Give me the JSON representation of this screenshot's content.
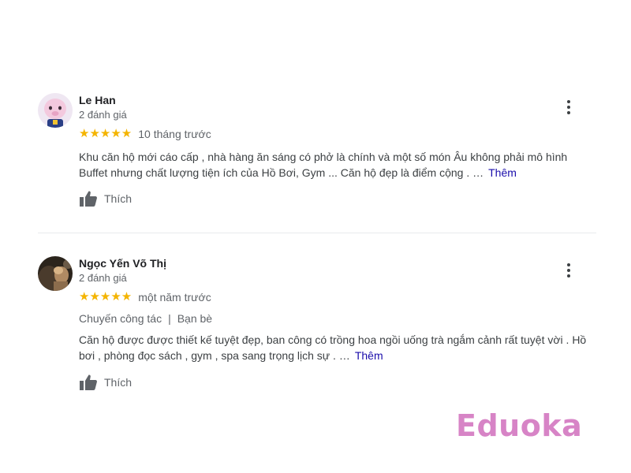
{
  "reviews": [
    {
      "name": "Le Han",
      "count": "2 đánh giá",
      "stars": "★★★★★",
      "time": "10 tháng trước",
      "text": "Khu căn hộ mới cáo cấp , nhà hàng ăn sáng có phở là chính và một số món Âu không phải mô hình Buffet nhưng chất lượng tiện ích của Hồ Bơi, Gym ... Căn hộ đẹp là điểm cộng . …",
      "more": "Thêm",
      "like": "Thích"
    },
    {
      "name": "Ngọc Yến Võ Thị",
      "count": "2 đánh giá",
      "stars": "★★★★★",
      "time": "một năm trước",
      "tags": [
        "Chuyến công tác",
        "Bạn bè"
      ],
      "tag_separator": "|",
      "text": "Căn hộ được được thiết kế tuyệt đẹp, ban công có trồng hoa ngồi uống trà ngắm cảnh rất tuyệt vời . Hồ bơi , phòng đọc sách , gym , spa sang trọng lịch sự . …",
      "more": "Thêm",
      "like": "Thích"
    }
  ],
  "watermark": "Eduoka",
  "colors": {
    "star": "#f4b400",
    "link": "#1a0dab",
    "watermark": "#d784c6",
    "divider": "#e8eaed"
  },
  "icons": {
    "menu": "more-vert-icon",
    "like": "thumbs-up-icon"
  }
}
